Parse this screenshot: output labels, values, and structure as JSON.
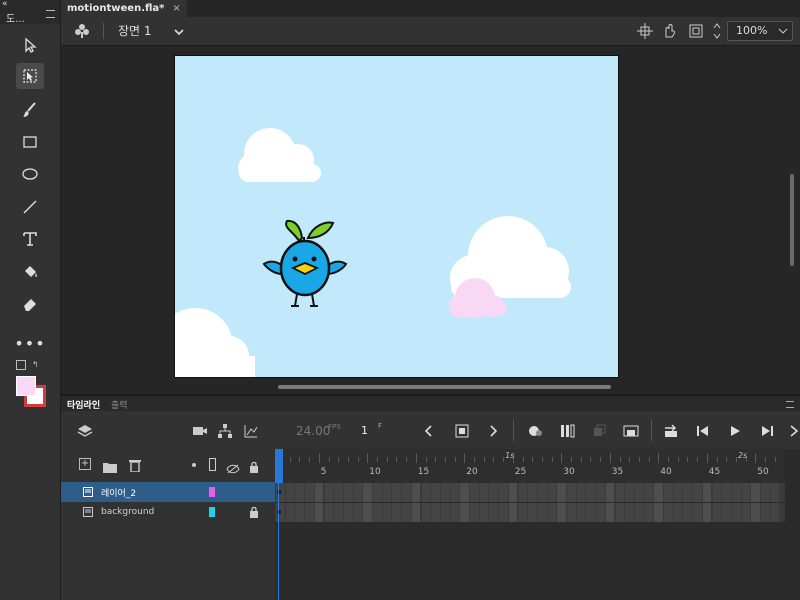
{
  "toolbar": {
    "panel_title": "도...",
    "collapse_glyph": "«",
    "tools": [
      "selection-tool",
      "free-transform-tool",
      "brush-tool",
      "rectangle-tool",
      "oval-tool",
      "line-tool",
      "text-tool",
      "paint-bucket-tool",
      "eraser-tool",
      "more-tools"
    ],
    "active_tool": "free-transform-tool",
    "stroke_color": "#d13c3c",
    "fill_color": "#f8d8f4"
  },
  "tab": {
    "title": "motiontween.fla*",
    "close": "×"
  },
  "editbar": {
    "scene_label": "장면 1",
    "zoom_value": "100%"
  },
  "stage": {
    "background": "#c1e9fb",
    "cloud_color": "#ffffff",
    "pink_cloud_color": "#f8d8f4",
    "bird_color": "#1aa7e6",
    "leaf_color": "#7ad12a",
    "beak_color": "#f6d20f"
  },
  "panel_tabs": {
    "timeline": "타임라인",
    "output": "출력"
  },
  "timeline": {
    "fps": "24.00",
    "fps_unit": "FPS",
    "current_frame": "1",
    "frame_unit": "F",
    "ruler_numbers": [
      "5",
      "10",
      "15",
      "20",
      "25",
      "30",
      "35",
      "40",
      "45",
      "50"
    ],
    "ruler_seconds": [
      "1s",
      "2s"
    ],
    "layers": [
      {
        "name": "레이어_2",
        "color": "#e65fe8",
        "selected": true,
        "locked": false
      },
      {
        "name": "background",
        "color": "#22d3e8",
        "selected": false,
        "locked": true
      }
    ]
  }
}
